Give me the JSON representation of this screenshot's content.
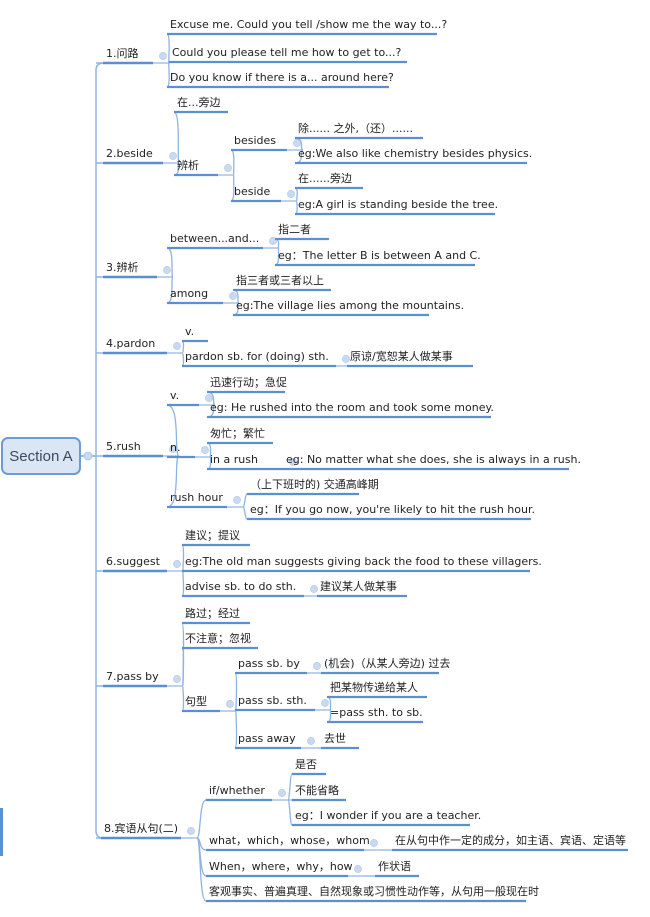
{
  "root": {
    "label": "Section A"
  },
  "colors": {
    "line": "#5b8fd0",
    "connector": "#8fb3e0",
    "collapse": "#c9d9ef",
    "root_fill": "#dbe6f4",
    "root_border": "#6d9bd4"
  },
  "topics": [
    {
      "label": "1.问路",
      "children": [
        {
          "label": "Excuse me. Could you tell /show me the way to...?"
        },
        {
          "label": "Could you please tell me how to get to...?"
        },
        {
          "label": "Do you know if there is a... around here?"
        }
      ]
    },
    {
      "label": "2.beside",
      "children": [
        {
          "label": "在...旁边"
        },
        {
          "label": "辨析",
          "children": [
            {
              "label": "besides",
              "children": [
                {
                  "label": "除...... 之外,（还）......"
                },
                {
                  "label": "eg:We also like chemistry besides physics."
                }
              ]
            },
            {
              "label": "beside",
              "children": [
                {
                  "label": "在......旁边"
                },
                {
                  "label": "eg:A girl is standing beside the tree."
                }
              ]
            }
          ]
        }
      ]
    },
    {
      "label": "3.辨析",
      "children": [
        {
          "label": "between...and...",
          "children": [
            {
              "label": "指二者"
            },
            {
              "label": "eg：The letter B is between A and C."
            }
          ]
        },
        {
          "label": "among",
          "children": [
            {
              "label": "指三者或三者以上"
            },
            {
              "label": "eg:The village lies among the mountains."
            }
          ]
        }
      ]
    },
    {
      "label": "4.pardon",
      "children": [
        {
          "label": "v."
        },
        {
          "label": "pardon sb. for (doing) sth.",
          "children": [
            {
              "label": "原谅/宽恕某人做某事"
            }
          ]
        }
      ]
    },
    {
      "label": "5.rush",
      "children": [
        {
          "label": "v.",
          "children": [
            {
              "label": "迅速行动；急促"
            },
            {
              "label": "eg: He rushed into the room and took some money."
            }
          ]
        },
        {
          "label": "n.",
          "children": [
            {
              "label": "匆忙；繁忙"
            },
            {
              "label": "in a rush",
              "children": [
                {
                  "label": "eg: No matter what she does, she is always in a rush."
                }
              ]
            }
          ]
        },
        {
          "label": "rush hour",
          "children": [
            {
              "label": "（上下班时的) 交通高峰期"
            },
            {
              "label": "eg：If you go now, you're likely to hit the rush hour."
            }
          ]
        }
      ]
    },
    {
      "label": "6.suggest",
      "children": [
        {
          "label": "建议；提议"
        },
        {
          "label": "eg:The old man suggests giving back the food to these villagers."
        },
        {
          "label": "advise sb. to do sth.",
          "children": [
            {
              "label": "建议某人做某事"
            }
          ]
        }
      ]
    },
    {
      "label": "7.pass by",
      "children": [
        {
          "label": "路过；经过"
        },
        {
          "label": "不注意；忽视"
        },
        {
          "label": "句型",
          "children": [
            {
              "label": "pass sb. by",
              "children": [
                {
                  "label": "(机会)（从某人旁边) 过去"
                }
              ]
            },
            {
              "label": "pass sb. sth.",
              "children": [
                {
                  "label": "把某物传递给某人"
                },
                {
                  "label": "=pass sth. to sb."
                }
              ]
            },
            {
              "label": "pass away",
              "children": [
                {
                  "label": "去世"
                }
              ]
            }
          ]
        }
      ]
    },
    {
      "label": "8.宾语从句(二)",
      "children": [
        {
          "label": "if/whether",
          "children": [
            {
              "label": "是否"
            },
            {
              "label": "不能省略"
            },
            {
              "label": "eg：I wonder if you are a teacher."
            }
          ]
        },
        {
          "label": "what，which，whose，whom",
          "children": [
            {
              "label": "在从句中作一定的成分，如主语、宾语、定语等"
            }
          ]
        },
        {
          "label": "When，where，why，how",
          "children": [
            {
              "label": "作状语"
            }
          ]
        },
        {
          "label": "客观事实、普遍真理、自然现象或习惯性动作等，从句用一般现在时"
        }
      ]
    }
  ]
}
